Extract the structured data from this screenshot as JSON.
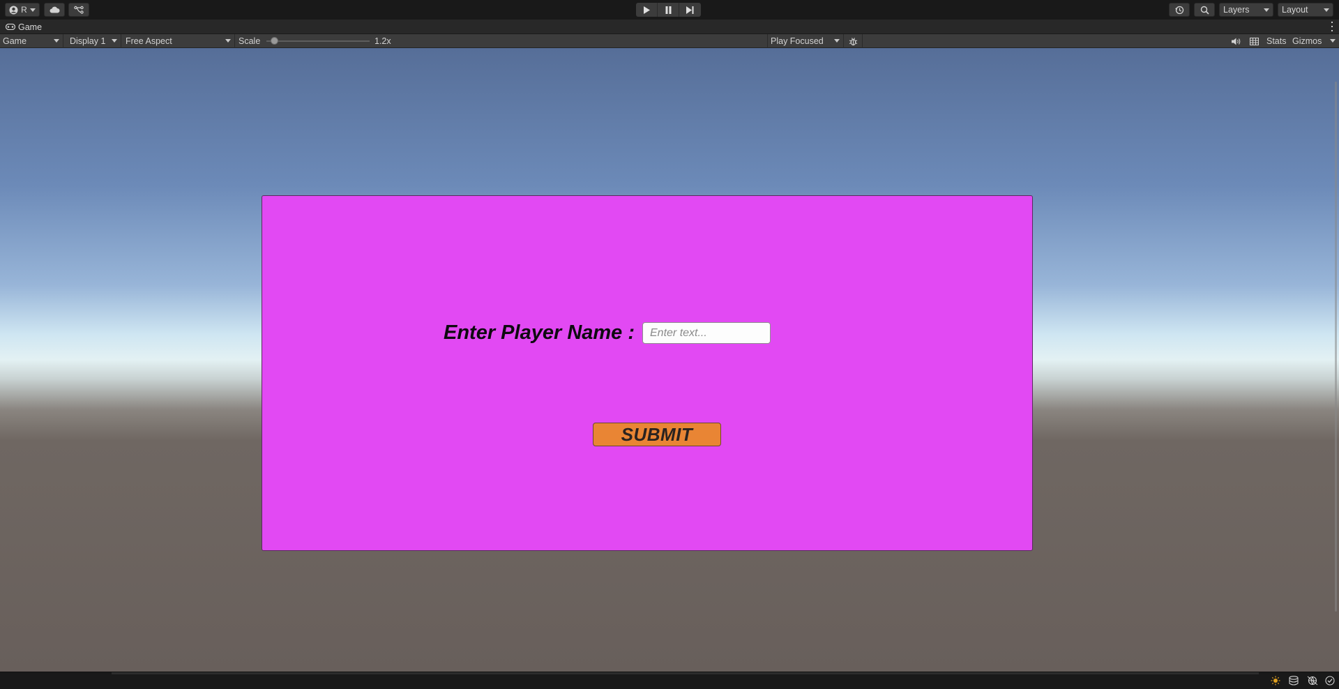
{
  "toolbar": {
    "account_label": "R",
    "layers_label": "Layers",
    "layout_label": "Layout"
  },
  "tab": {
    "label": "Game"
  },
  "game_toolbar": {
    "view_mode": "Game",
    "display": "Display 1",
    "aspect": "Free Aspect",
    "scale_label": "Scale",
    "scale_value": "1.2x",
    "scale_fraction": 0.08,
    "play_mode": "Play Focused",
    "stats_label": "Stats",
    "gizmos_label": "Gizmos"
  },
  "game": {
    "label": "Enter Player Name :",
    "input_placeholder": "Enter text...",
    "input_value": "",
    "submit_label": "SUBMIT",
    "panel_color": "#e249f3",
    "button_color": "#e98534"
  },
  "icons": {
    "toolbar": [
      "account-icon",
      "cloud-icon",
      "collab-icon",
      "play-icon",
      "pause-icon",
      "step-icon",
      "history-icon",
      "search-icon"
    ],
    "game_toolbar": [
      "bug-icon",
      "audio-icon",
      "grid-icon"
    ],
    "status": [
      "lighting-icon",
      "cache-icon",
      "network-icon",
      "check-icon"
    ]
  }
}
